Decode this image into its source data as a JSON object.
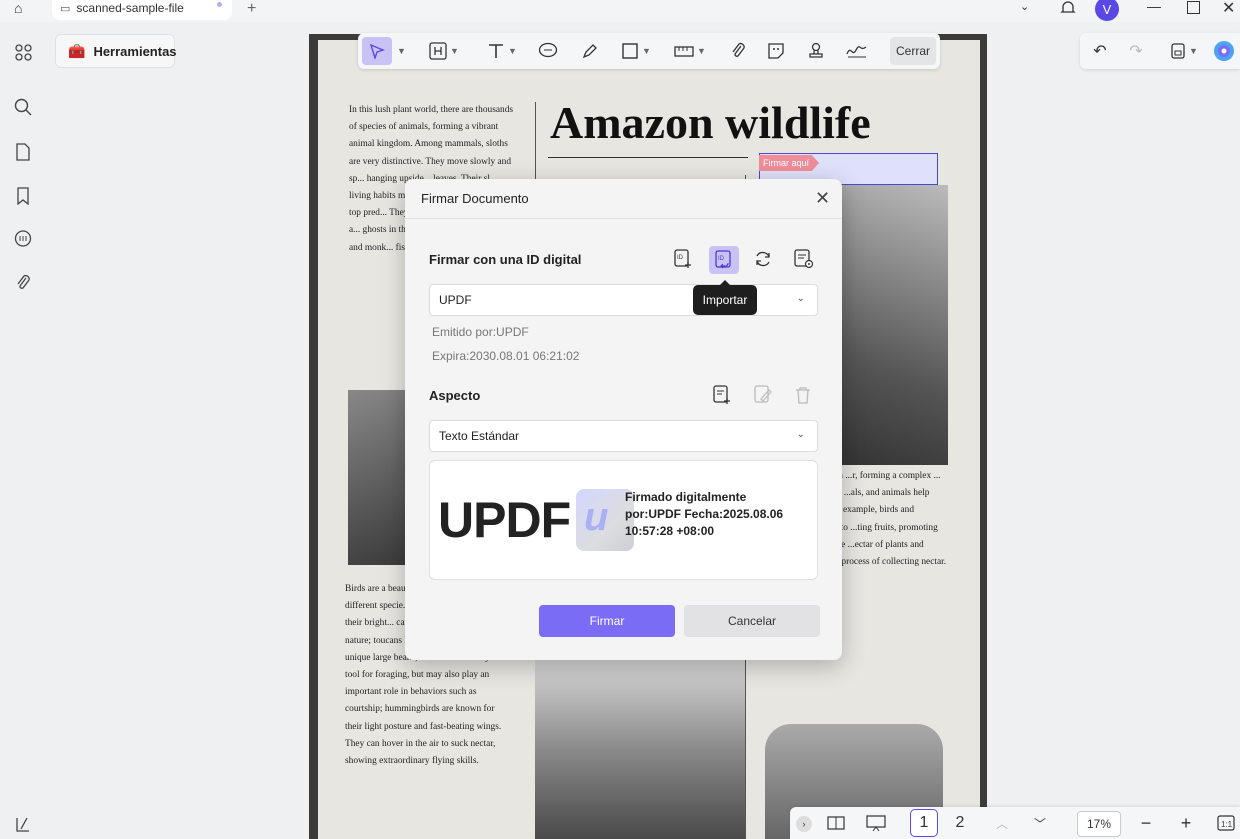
{
  "app": {
    "tab_title": "scanned-sample-file",
    "new_tab": "+",
    "avatar_initial": "V",
    "accent": "#5a48e6"
  },
  "left_rail": {
    "icons": [
      "apps-grid-icon",
      "search-icon",
      "pages-icon",
      "bookmark-icon",
      "comment-icon",
      "attachment-icon"
    ],
    "bottom_icon": "layers-icon"
  },
  "tools_button": {
    "label": "Herramientas"
  },
  "toolbar": {
    "close_label": "Cerrar",
    "tools": [
      "select",
      "text-box",
      "text",
      "comment",
      "highlighter",
      "shape",
      "measure",
      "attachment",
      "sticker",
      "stamp",
      "signature"
    ]
  },
  "document": {
    "headline": "Amazon wildlife",
    "sign_field_tag": "Firmar aquí",
    "col1": "In this lush plant world, there are thousands of species of animals, forming a vibrant animal kingdom. Among mammals, sloths are very distinctive. They move slowly and sp... hanging upside... leaves. Their sl... living habits m... representatives... are the top pred... They are cover... markings and a... ghosts in the ju... jaguars can not... deer and monk... fish, turtles and... water.",
    "col1b": "Birds are a beau... rainforest. Ther... different specie... through the fore... and their bright... carefully painted painting by nature; toucans have exaggerated and unique large beaks, which are not only a tool for foraging, but may also play an important role in behaviors such as courtship; hummingbirds are known for their light posture and fast-beating wings. They can hover in the air to suck nectar, showing extraordinary flying skills.",
    "col3": "...nts in the Amazon ...r, forming a complex ... Plants provide food ...als, and animals help ...and control the ... example, birds and ...undigested seeds to ...ting fruits, promoting ...plants; while some ...ectar of plants and ...pollination in the process of collecting nectar."
  },
  "dialog": {
    "title": "Firmar Documento",
    "section_id": "Firmar con una ID digital",
    "id_select": "UPDF",
    "tooltip": "Importar",
    "issued_by": "Emitido por:UPDF",
    "expires": "Expira:2030.08.01 06:21:02",
    "section_aspect": "Aspecto",
    "aspect_select": "Texto Estándar",
    "preview": {
      "big_text": "UPDF",
      "details": "Firmado digitalmente por:UPDF Fecha:2025.08.06 10:57:28 +08:00"
    },
    "sign_button": "Firmar",
    "cancel_button": "Cancelar"
  },
  "bottom_bar": {
    "pages": [
      "1",
      "2"
    ],
    "current_page": "1",
    "zoom": "17%",
    "zoom_out": "−",
    "zoom_in": "+"
  }
}
